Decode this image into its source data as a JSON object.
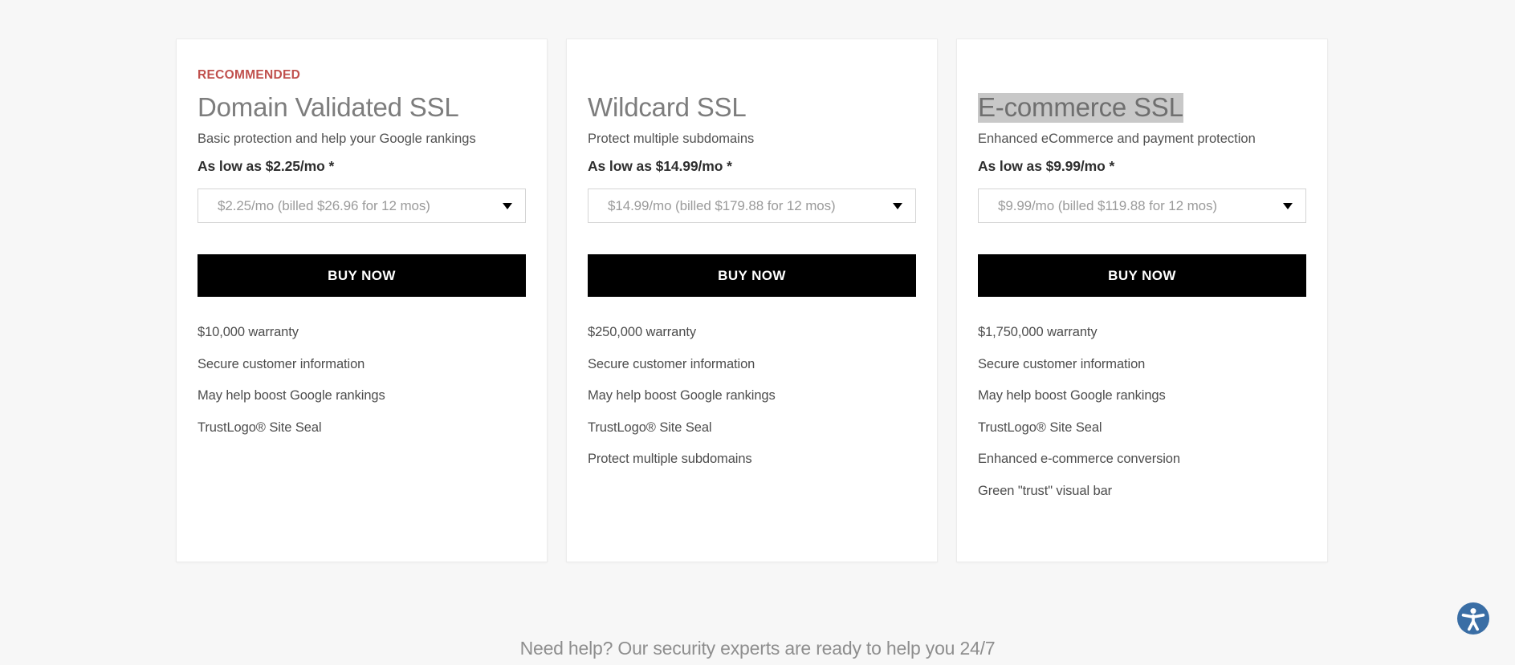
{
  "colors": {
    "page_bg": "#f7f7f7",
    "card_bg": "#ffffff",
    "recommended_accent": "#c0504d",
    "buy_button_bg": "#000000",
    "selection_highlight": "#c8c8c8",
    "a11y_blue": "#3a6ea5"
  },
  "cards": [
    {
      "badge": "RECOMMENDED",
      "title": "Domain Validated SSL",
      "subtitle": "Basic protection and help your Google rankings",
      "price_line": "As low as $2.25/mo *",
      "select_value": "$2.25/mo (billed $26.96 for 12 mos)",
      "buy_label": "BUY NOW",
      "features": [
        "$10,000 warranty",
        "Secure customer information",
        "May help boost Google rankings",
        "TrustLogo® Site Seal"
      ]
    },
    {
      "badge": "",
      "title": "Wildcard SSL",
      "subtitle": "Protect multiple subdomains",
      "price_line": "As low as $14.99/mo *",
      "select_value": "$14.99/mo (billed $179.88 for 12 mos)",
      "buy_label": "BUY NOW",
      "features": [
        "$250,000 warranty",
        "Secure customer information",
        "May help boost Google rankings",
        "TrustLogo® Site Seal",
        "Protect multiple subdomains"
      ]
    },
    {
      "badge": "",
      "title": "E-commerce SSL",
      "title_selected": true,
      "subtitle": "Enhanced eCommerce and payment protection",
      "price_line": "As low as $9.99/mo *",
      "select_value": "$9.99/mo (billed $119.88 for 12 mos)",
      "buy_label": "BUY NOW",
      "features": [
        "$1,750,000 warranty",
        "Secure customer information",
        "May help boost Google rankings",
        "TrustLogo® Site Seal",
        "Enhanced e-commerce conversion",
        "Green \"trust\" visual bar"
      ]
    }
  ],
  "footer": {
    "help_text": "Need help? Our security experts are ready to help you 24/7"
  },
  "accessibility_widget": {
    "icon": "accessibility-person-icon"
  }
}
